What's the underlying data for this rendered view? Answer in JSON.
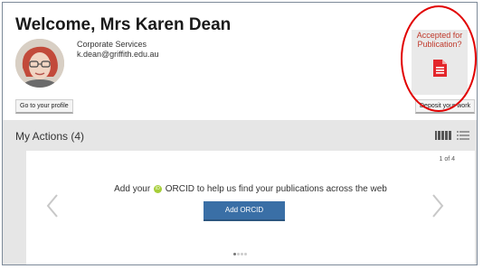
{
  "header": {
    "welcome": "Welcome, Mrs Karen Dean",
    "department": "Corporate Services",
    "email": "k.dean@griffith.edu.au",
    "profile_button": "Go to your profile",
    "deposit_button": "Deposit your work",
    "publication_prompt_line1": "Accepted for",
    "publication_prompt_line2": "Publication?",
    "publication_icon": "document-icon",
    "accent_color": "#c0392b"
  },
  "actions": {
    "title": "My Actions (4)",
    "view_modes": [
      "grid-view-icon",
      "list-view-icon"
    ],
    "card": {
      "pager": "1 of 4",
      "text_before": "Add your",
      "text_after": "ORCID to help us find your publications across the web",
      "button": "Add ORCID",
      "button_color": "#3a6fa6",
      "slide_count": 4,
      "active_slide": 1
    }
  },
  "annotation": {
    "highlight_color": "#e10000"
  }
}
